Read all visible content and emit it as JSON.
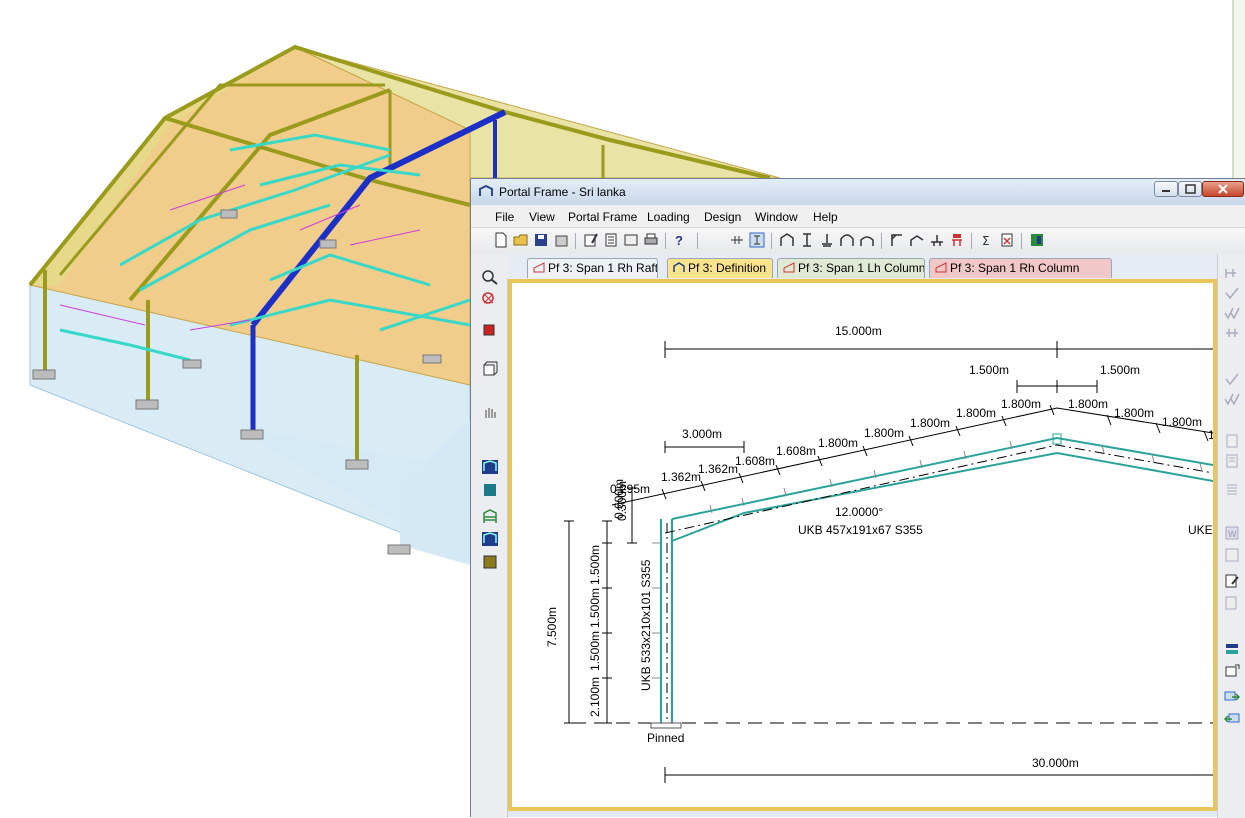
{
  "window": {
    "title": "Portal Frame - Sri lanka"
  },
  "menu": {
    "items": [
      "File",
      "View",
      "Portal Frame",
      "Loading",
      "Design",
      "Window",
      "Help"
    ]
  },
  "tabs": [
    {
      "label": "Pf 3: Span 1 Rh Rafter",
      "active": false
    },
    {
      "label": "Pf 3: Definition",
      "active": true
    },
    {
      "label": "Pf 3: Span 1 Lh Column",
      "active": false
    },
    {
      "label": "Pf 3: Span 1 Rh Column",
      "active": false
    }
  ],
  "tab_controls": {
    "menu_glyph": "▼",
    "close_glyph": "✕"
  },
  "drawing": {
    "dims_top": {
      "half_span": "15.000m",
      "apex_left": "1.500m",
      "apex_right": "1.500m",
      "haunch": "3.000m"
    },
    "rafter_segments": [
      "0.295m",
      "1.362m",
      "1.362m",
      "1.608m",
      "1.608m",
      "1.800m",
      "1.800m",
      "1.800m",
      "1.800m",
      "1.800m",
      "1.800m",
      "1.800m",
      "1.800m",
      "1.800m",
      "1"
    ],
    "pitch": "12.0000°",
    "rafter_section": "UKB 457x191x67 S355",
    "right_rafter_section_partial": "UKE",
    "column_section": "UKB 533x210x101 S355",
    "column_dims": [
      "0.300m",
      "1.500m",
      "1.500m",
      "1.500m",
      "2.100m"
    ],
    "eaves_height": "7.500m",
    "haunch_depth": "0.600m",
    "base": "Pinned",
    "span": "30.000m"
  },
  "colors": {
    "member": "#2aa39a",
    "frame_border": "#e8c65c",
    "active_tab": "#fbe48c",
    "roof_fill": "#f1cf8e",
    "steel_olive": "#9a9a1c",
    "steel_blue": "#1c2fc6",
    "steel_cyan": "#38d8c8"
  }
}
